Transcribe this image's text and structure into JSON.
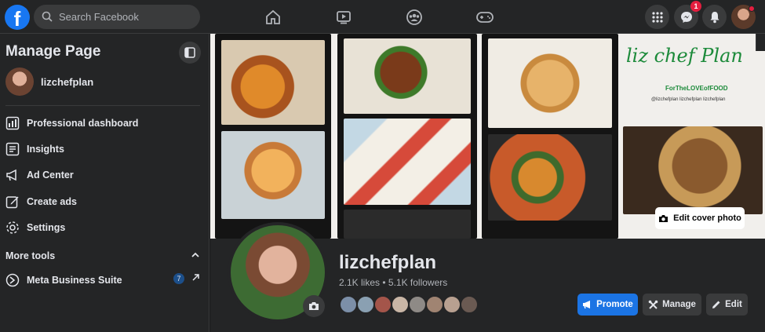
{
  "topbar": {
    "search": {
      "placeholder": "Search Facebook"
    },
    "nav": [
      {
        "name": "home-icon"
      },
      {
        "name": "watch-icon"
      },
      {
        "name": "groups-icon"
      },
      {
        "name": "gaming-icon"
      }
    ],
    "messenger_badge": "1"
  },
  "sidebar": {
    "title": "Manage Page",
    "page_name": "lizchefplan",
    "items": [
      {
        "label": "Professional dashboard",
        "icon": "dashboard-icon"
      },
      {
        "label": "Insights",
        "icon": "insights-icon"
      },
      {
        "label": "Ad Center",
        "icon": "megaphone-icon"
      },
      {
        "label": "Create ads",
        "icon": "pencil-square-icon"
      },
      {
        "label": "Settings",
        "icon": "gear-icon"
      }
    ],
    "more_tools": "More tools",
    "meta_business_suite": {
      "label": "Meta Business Suite",
      "badge": "7"
    }
  },
  "cover": {
    "edit_cover_label": "Edit cover photo",
    "brand": {
      "logo_text": "liz chef Plan",
      "tagline": "ForTheLOVEofFOOD",
      "handles": "@lizchefplan   lizchefplan   lizchefplan"
    }
  },
  "profile": {
    "name": "lizchefplan",
    "stats": "2.1K likes • 5.1K followers"
  },
  "actions": {
    "promote": "Promote",
    "manage": "Manage",
    "edit": "Edit"
  },
  "colors": {
    "primary": "#1b74e4",
    "background": "#18191a",
    "surface": "#242526",
    "badge": "#e41e3f"
  }
}
